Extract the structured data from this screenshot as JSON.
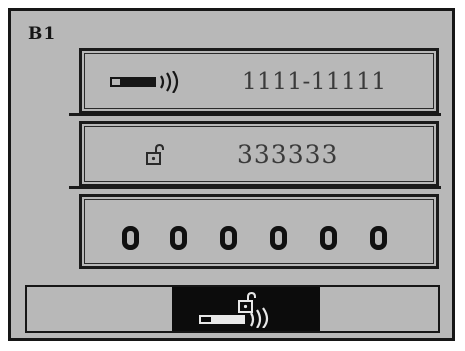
{
  "screen": {
    "label": "B1"
  },
  "fields": {
    "network_id": {
      "icon": "signal-key-icon",
      "value": "1111-11111"
    },
    "pin": {
      "icon": "unlock-icon",
      "value": "333333"
    },
    "code": {
      "digits": [
        "0",
        "0",
        "0",
        "0",
        "0",
        "0"
      ]
    }
  },
  "tabs": {
    "active_icon": "unlock-signal-icon"
  },
  "colors": {
    "screen_bg": "#b8b8b8",
    "ink": "#161616",
    "text": "#3a3a3a"
  }
}
